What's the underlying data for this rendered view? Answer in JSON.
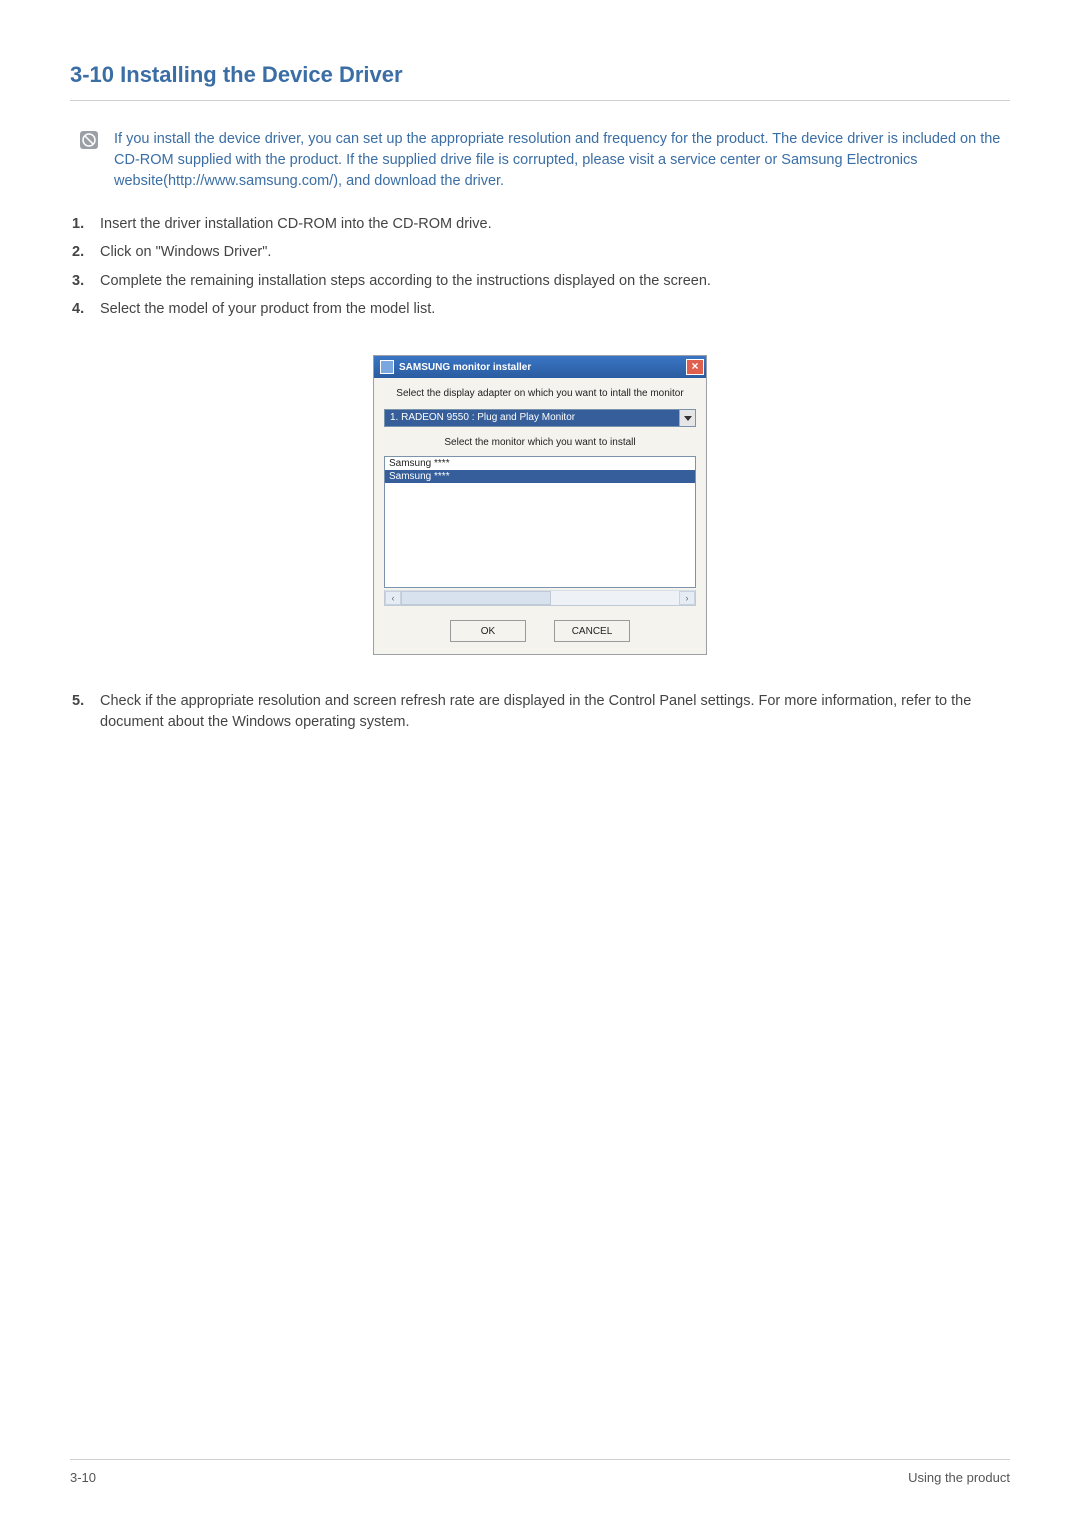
{
  "heading": "3-10  Installing the Device Driver",
  "note_icon_name": "info-icon",
  "note": "If you install the device driver, you can set up the appropriate resolution and frequency for the product. The device driver is included on the CD-ROM supplied with the product. If the supplied drive file is corrupted, please visit a service center or Samsung Electronics website(http://www.samsung.com/), and download the driver.",
  "steps": [
    {
      "num": "1.",
      "text": "Insert the driver installation CD-ROM into the CD-ROM drive."
    },
    {
      "num": "2.",
      "text": "Click on \"Windows Driver\"."
    },
    {
      "num": "3.",
      "text": "Complete the remaining installation steps according to the instructions displayed on the screen."
    },
    {
      "num": "4.",
      "text": "Select the model of your product from the model list."
    }
  ],
  "installer": {
    "title": "SAMSUNG monitor installer",
    "close_label": "×",
    "label_adapter": "Select the display adapter on which you want to intall the monitor",
    "adapter_value": "1. RADEON 9550 : Plug and Play Monitor",
    "label_monitor": "Select the monitor which you want to install",
    "monitors": [
      {
        "label": "Samsung ****",
        "selected": false
      },
      {
        "label": "Samsung ****",
        "selected": true
      }
    ],
    "scroll_left": "‹",
    "scroll_right": "›",
    "ok_label": "OK",
    "cancel_label": "CANCEL"
  },
  "step5": {
    "num": "5.",
    "text": "Check if the appropriate resolution and screen refresh rate are displayed in the Control Panel settings. For more information, refer to the document about the Windows operating system."
  },
  "footer": {
    "left": "3-10",
    "right": "Using the product"
  }
}
